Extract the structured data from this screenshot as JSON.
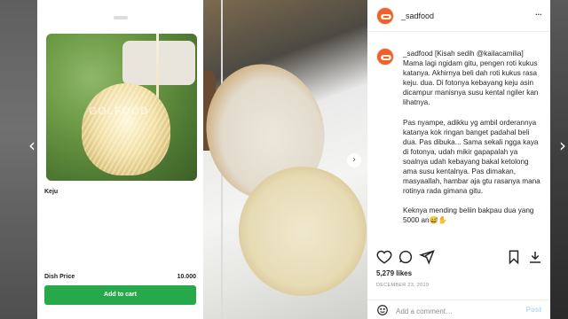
{
  "navigation": {
    "prev_glyph": "‹",
    "next_glyph": "›"
  },
  "media": {
    "phone_screen": {
      "watermark": "GOLFOOD",
      "dish_name": "Keju",
      "price_label": "Dish Price",
      "price_value": "10.000",
      "cart_button": "Add to cart",
      "accent_color": "#27a84a"
    },
    "carousel_next_glyph": "›"
  },
  "post": {
    "username": "_sadfood",
    "more_glyph": "···",
    "caption": {
      "username": "_sadfood",
      "p1": "[Kisah sedih @kailacamilia] Mama lagi ngidam gitu, pengen roti kukus katanya. Akhirnya beli dah roti kukus rasa keju. dua. Di fotonya kebayang keju asin dicampur manisnya susu kental ngiler kan lihatnya.",
      "p2": "Pas nyampe, adikku yg ambil orderannya katanya kok ringan banget padahal beli dua. Pas dibuka... Sama sekali ngga kaya di fotonya, udah mikir gapapalah ya soalnya udah kebayang bakal ketolong ama susu kentalnya. Pas dimakan, masyaallah, hambar aja gtu rasanya mana rotinya rada gimana gitu.",
      "p3": "Keknya mending beliin bakpau dua yang 5000 an😅✋"
    },
    "likes": "5,279 likes",
    "date": "DECEMBER 23, 2019",
    "comment_placeholder": "Add a comment…",
    "post_button": "Post",
    "icons": [
      "heart-icon",
      "comment-icon",
      "share-icon",
      "bookmark-icon",
      "download-icon",
      "emoji-icon"
    ]
  }
}
